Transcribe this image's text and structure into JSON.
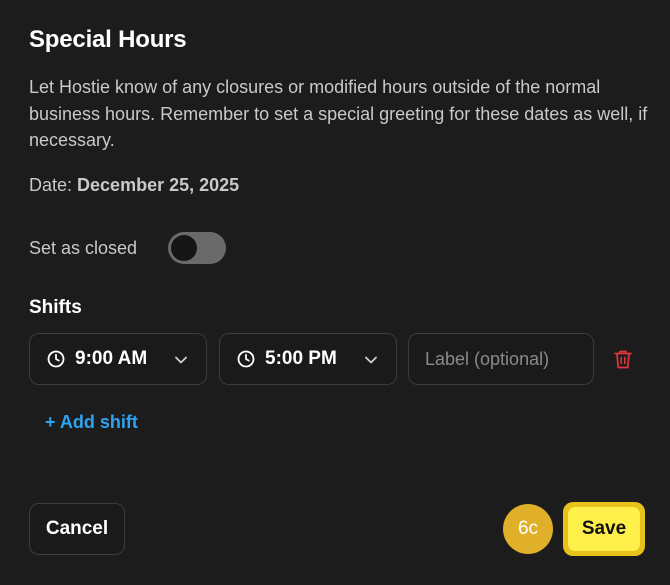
{
  "dialog": {
    "title": "Special Hours",
    "description": "Let Hostie know of any closures or modified hours outside of the normal business hours. Remember to set a special greeting for these dates as well, if necessary.",
    "date_label": "Date: ",
    "date_value": "December 25, 2025",
    "closed_label": "Set as closed",
    "closed_toggle_on": false
  },
  "shifts": {
    "heading": "Shifts",
    "rows": [
      {
        "start_time": "9:00 AM",
        "end_time": "5:00 PM",
        "label_value": "",
        "label_placeholder": "Label (optional)"
      }
    ],
    "add_label": "+ Add shift"
  },
  "footer": {
    "cancel_label": "Cancel",
    "badge_text": "6c",
    "save_label": "Save"
  },
  "colors": {
    "background": "#1c1c1c",
    "link": "#2ea3f2",
    "danger": "#d9363e",
    "save_bg": "#ffef4a",
    "save_border": "#e6c21a",
    "badge_bg": "#e0b02a"
  },
  "icons": {
    "clock": "clock-icon",
    "chevron": "chevron-down-icon",
    "trash": "trash-icon"
  }
}
